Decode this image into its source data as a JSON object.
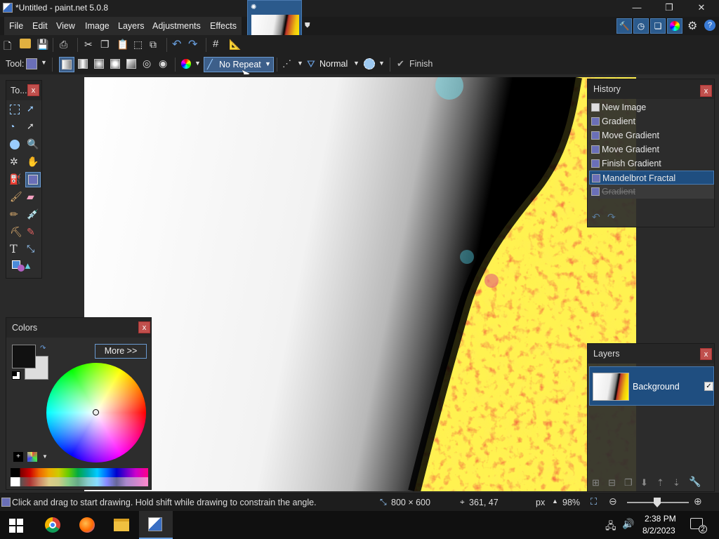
{
  "window": {
    "title": "*Untitled - paint.net 5.0.8"
  },
  "menu": [
    "File",
    "Edit",
    "View",
    "Image",
    "Layers",
    "Adjustments",
    "Effects"
  ],
  "toolbar": {
    "tool_label": "Tool:",
    "repeat_mode": "No Repeat",
    "blend_mode": "Normal",
    "finish_label": "Finish"
  },
  "tools_panel": {
    "title": "To..."
  },
  "history": {
    "title": "History",
    "items": [
      "New Image",
      "Gradient",
      "Move Gradient",
      "Move Gradient",
      "Finish Gradient",
      "Mandelbrot Fractal",
      "Gradient"
    ],
    "selected_index": 5,
    "dimmed_index": 6
  },
  "layers": {
    "title": "Layers",
    "items": [
      {
        "name": "Background",
        "visible": true
      }
    ]
  },
  "colors": {
    "title": "Colors",
    "more_label": "More >>",
    "primary": "#111111",
    "secondary": "#dddddd"
  },
  "status": {
    "hint": "Click and drag to start drawing. Hold shift while drawing to constrain the angle.",
    "image_size": "800 × 600",
    "cursor_pos": "361, 47",
    "units": "px",
    "zoom": "98%"
  },
  "taskbar": {
    "time": "2:38 PM",
    "date": "8/2/2023",
    "notifications": "2"
  },
  "colors_theme": {
    "accent": "#2b5a8c",
    "selected": "#1f4e80"
  }
}
